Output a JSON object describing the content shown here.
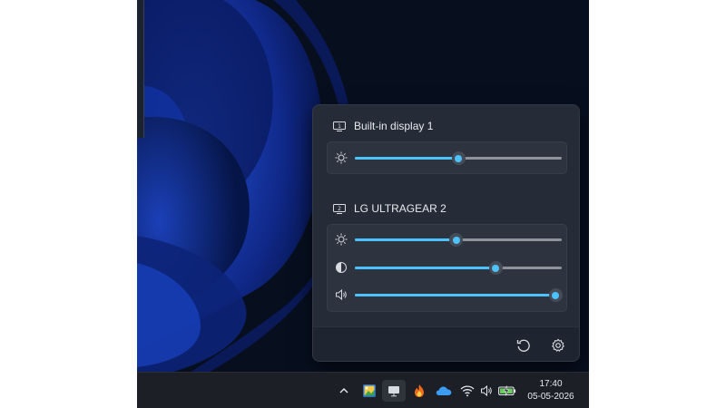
{
  "flyout": {
    "monitors": [
      {
        "name": "Built-in display 1",
        "icon": "monitor-1-icon",
        "controls": [
          {
            "type": "brightness",
            "icon": "brightness-icon",
            "value": 0.5
          }
        ]
      },
      {
        "name": "LG ULTRAGEAR 2",
        "icon": "monitor-2-icon",
        "controls": [
          {
            "type": "brightness",
            "icon": "brightness-icon",
            "value": 0.49
          },
          {
            "type": "contrast",
            "icon": "contrast-icon",
            "value": 0.68
          },
          {
            "type": "volume",
            "icon": "volume-icon",
            "value": 0.97
          }
        ]
      }
    ],
    "footer": {
      "reset_icon": "refresh-icon",
      "settings_icon": "gear-icon"
    }
  },
  "taskbar": {
    "tray_icons": [
      "chevron-up-icon",
      "photos-app-icon",
      "monitor-tray-icon",
      "flame-app-icon",
      "onedrive-icon"
    ],
    "status_icons": [
      "wifi-icon",
      "volume-icon",
      "battery-charging-icon"
    ],
    "clock": {
      "time": "17:40",
      "date": "05-05-2026"
    }
  },
  "colors": {
    "accent": "#4cc2ff",
    "flyout_bg": "#252c38",
    "card_bg": "#2d3440",
    "taskbar_bg": "#1c1f25",
    "wallpaper_blue": "#1a3fa8"
  }
}
